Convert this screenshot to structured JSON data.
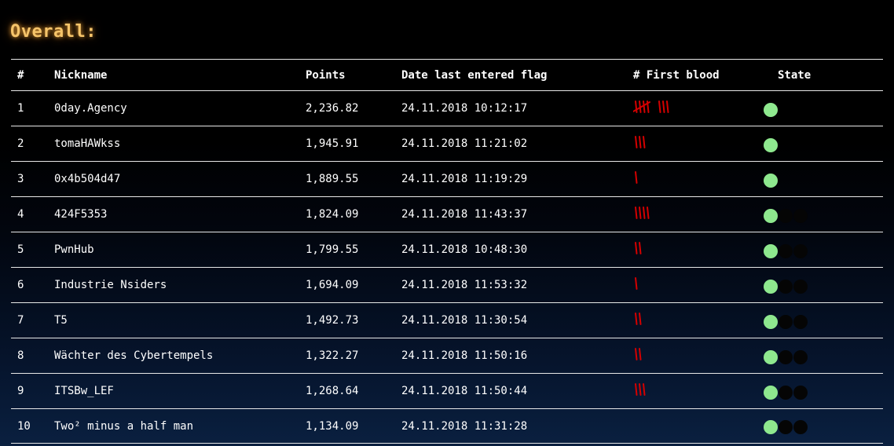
{
  "page": {
    "title": "Overall:"
  },
  "colors": {
    "title": "#f5c46a",
    "tally": "#d40000",
    "state_active": "#8ee88e",
    "state_inactive": "#050505"
  },
  "table": {
    "headers": {
      "rank": "#",
      "nickname": "Nickname",
      "points": "Points",
      "date": "Date last entered flag",
      "first_blood": "# First blood",
      "state": "State"
    },
    "rows": [
      {
        "rank": "1",
        "nickname": "0day.Agency",
        "points": "2,236.82",
        "date": "24.11.2018 10:12:17",
        "first_blood": 8,
        "state": [
          "green"
        ]
      },
      {
        "rank": "2",
        "nickname": "tomaHAWkss",
        "points": "1,945.91",
        "date": "24.11.2018 11:21:02",
        "first_blood": 3,
        "state": [
          "green"
        ]
      },
      {
        "rank": "3",
        "nickname": "0x4b504d47",
        "points": "1,889.55",
        "date": "24.11.2018 11:19:29",
        "first_blood": 1,
        "state": [
          "green"
        ]
      },
      {
        "rank": "4",
        "nickname": "424F5353",
        "points": "1,824.09",
        "date": "24.11.2018 11:43:37",
        "first_blood": 4,
        "state": [
          "green",
          "dark",
          "dark"
        ]
      },
      {
        "rank": "5",
        "nickname": "PwnHub",
        "points": "1,799.55",
        "date": "24.11.2018 10:48:30",
        "first_blood": 2,
        "state": [
          "green",
          "dark",
          "dark"
        ]
      },
      {
        "rank": "6",
        "nickname": "Industrie Nsiders",
        "points": "1,694.09",
        "date": "24.11.2018 11:53:32",
        "first_blood": 1,
        "state": [
          "green",
          "dark",
          "dark"
        ]
      },
      {
        "rank": "7",
        "nickname": "T5",
        "points": "1,492.73",
        "date": "24.11.2018 11:30:54",
        "first_blood": 2,
        "state": [
          "green",
          "dark",
          "dark"
        ]
      },
      {
        "rank": "8",
        "nickname": "Wächter des Cybertempels",
        "points": "1,322.27",
        "date": "24.11.2018 11:50:16",
        "first_blood": 2,
        "state": [
          "green",
          "dark",
          "dark"
        ]
      },
      {
        "rank": "9",
        "nickname": "ITSBw_LEF",
        "points": "1,268.64",
        "date": "24.11.2018 11:50:44",
        "first_blood": 3,
        "state": [
          "green",
          "dark",
          "dark"
        ]
      },
      {
        "rank": "10",
        "nickname": "Two² minus a half man",
        "points": "1,134.09",
        "date": "24.11.2018 11:31:28",
        "first_blood": 0,
        "state": [
          "green",
          "dark",
          "dark"
        ]
      }
    ]
  }
}
